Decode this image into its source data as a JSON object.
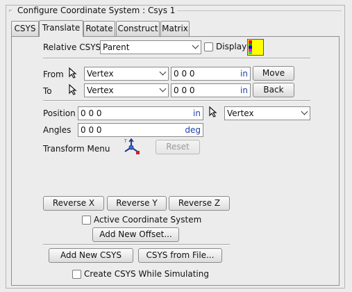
{
  "panel": {
    "title": "Configure Coordinate System : Csys 1"
  },
  "tabs": [
    {
      "label": "CSYS",
      "active": false
    },
    {
      "label": "Translate",
      "active": true
    },
    {
      "label": "Rotate",
      "active": false
    },
    {
      "label": "Construct",
      "active": false
    },
    {
      "label": "Matrix",
      "active": false
    }
  ],
  "relative": {
    "label": "Relative CSYS",
    "value": "Parent",
    "display_label": "Display",
    "display_checked": false,
    "swatch_color": "#ffff00"
  },
  "from": {
    "label": "From",
    "type": "Vertex",
    "value": "0 0 0",
    "unit": "in",
    "button": "Move"
  },
  "to": {
    "label": "To",
    "type": "Vertex",
    "value": "0 0 0",
    "unit": "in",
    "button": "Back"
  },
  "position": {
    "label": "Position",
    "value": "0 0 0",
    "unit": "in",
    "type": "Vertex"
  },
  "angles": {
    "label": "Angles",
    "value": "0 0 0",
    "unit": "deg"
  },
  "transform": {
    "label": "Transform Menu",
    "reset_label": "Reset"
  },
  "reverse": {
    "x": "Reverse X",
    "y": "Reverse Y",
    "z": "Reverse Z"
  },
  "active_csys": {
    "label": "Active Coordinate System",
    "checked": false
  },
  "add_offset": "Add New Offset...",
  "add_csys": "Add New CSYS",
  "csys_file": "CSYS from File...",
  "simulating": {
    "label": "Create CSYS While Simulating",
    "checked": false
  },
  "colors": {
    "unit_text": "#1c3fb0",
    "accent_swatch": "#ffff00"
  }
}
